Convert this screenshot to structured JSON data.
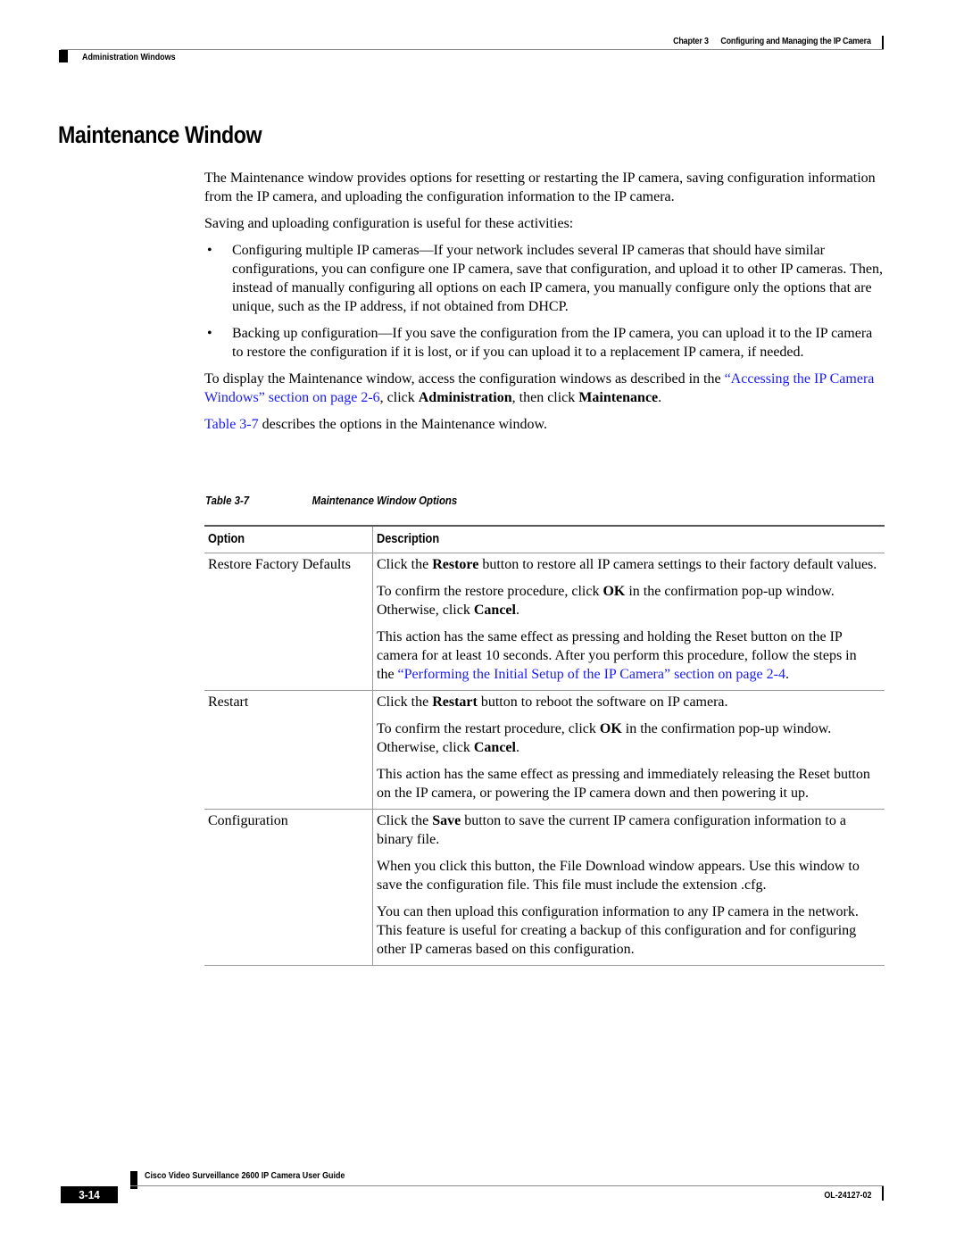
{
  "header": {
    "chapter_label": "Chapter 3",
    "chapter_title": "Configuring and Managing the IP Camera",
    "section": "Administration Windows"
  },
  "title": "Maintenance Window",
  "intro": {
    "p1": "The Maintenance window provides options for resetting or restarting the IP camera, saving configuration information from the IP camera, and uploading the configuration information to the IP camera.",
    "p2": "Saving and uploading configuration is useful for these activities:",
    "bullets": [
      "Configuring multiple IP cameras—If your network includes several IP cameras that should have similar configurations, you can configure one IP camera, save that configuration, and upload it to other IP cameras. Then, instead of manually configuring all options on each IP camera, you manually configure only the options that are unique, such as the IP address, if not obtained from DHCP.",
      "Backing up configuration—If you save the configuration from the IP camera, you can upload it to the IP camera to restore the configuration if it is lost, or if you can upload it to a replacement IP camera, if needed."
    ],
    "bullet_glyph": "•",
    "p3_pre": "To display the Maintenance window, access the configuration windows as described in the ",
    "p3_link": "“Accessing the IP Camera Windows” section on page 2-6",
    "p3_mid": ", click ",
    "p3_bold1": "Administration",
    "p3_mid2": ", then click ",
    "p3_bold2": "Maintenance",
    "p3_end": ".",
    "p4_link": "Table 3-7",
    "p4_rest": " describes the options in the Maintenance window."
  },
  "table": {
    "caption_number": "Table 3-7",
    "caption_title": "Maintenance Window Options",
    "col_option": "Option",
    "col_description": "Description",
    "rows": [
      {
        "option": "Restore Factory Defaults",
        "d1_pre": "Click the ",
        "d1_bold": "Restore",
        "d1_post": " button to restore all IP camera settings to their factory default values.",
        "d2_pre": "To confirm the restore procedure, click ",
        "d2_bold1": "OK",
        "d2_mid": " in the confirmation pop-up window. Otherwise, click ",
        "d2_bold2": "Cancel",
        "d2_end": ".",
        "d3_pre": "This action has the same effect as pressing and holding the Reset button on the IP camera for at least 10 seconds. After you perform this procedure, follow the steps in the ",
        "d3_link": "“Performing the Initial Setup of the IP Camera” section on page 2-4",
        "d3_end": "."
      },
      {
        "option": "Restart",
        "d1_pre": "Click the ",
        "d1_bold": "Restart",
        "d1_post": " button to reboot the software on IP camera.",
        "d2_pre": "To confirm the restart procedure, click ",
        "d2_bold1": "OK",
        "d2_mid": " in the confirmation pop-up window. Otherwise, click ",
        "d2_bold2": "Cancel",
        "d2_end": ".",
        "d3": "This action has the same effect as pressing and immediately releasing the Reset button on the IP camera, or powering the IP camera down and then powering it up."
      },
      {
        "option": "Configuration",
        "d1_pre": "Click the ",
        "d1_bold": "Save",
        "d1_post": " button to save the current IP camera configuration information to a binary file.",
        "d2": "When you click this button, the File Download window appears. Use this window to save the configuration file. This file must include the extension .cfg.",
        "d3": "You can then upload this configuration information to any IP camera in the network. This feature is useful for creating a backup of this configuration and for configuring other IP cameras based on this configuration."
      }
    ]
  },
  "footer": {
    "guide_title": "Cisco Video Surveillance 2600 IP Camera User Guide",
    "page_number": "3-14",
    "doc_id": "OL-24127-02"
  }
}
